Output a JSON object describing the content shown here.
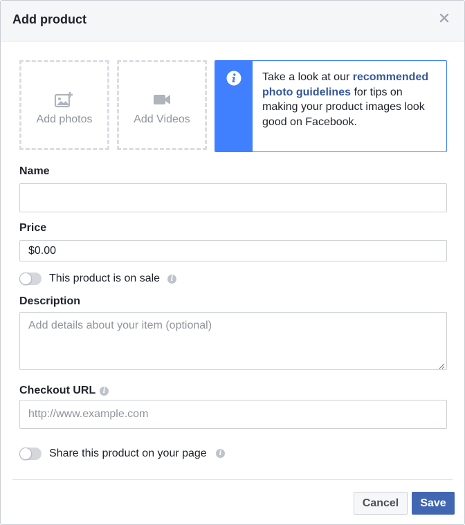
{
  "dialog": {
    "title": "Add product"
  },
  "media": {
    "add_photos_label": "Add photos",
    "add_videos_label": "Add Videos"
  },
  "info": {
    "text_before": "Take a look at our ",
    "link_text": "recommended photo guidelines",
    "text_after": " for tips on making your product images look good on Facebook."
  },
  "form": {
    "name_label": "Name",
    "name_value": "",
    "price_label": "Price",
    "price_value": "$0.00",
    "sale_toggle_label": "This product is on sale",
    "description_label": "Description",
    "description_placeholder": "Add details about your item (optional)",
    "checkout_label": "Checkout URL",
    "checkout_placeholder": "http://www.example.com",
    "share_toggle_label": "Share this product on your page"
  },
  "footer": {
    "cancel_label": "Cancel",
    "save_label": "Save"
  },
  "colors": {
    "accent_blue": "#4080ff",
    "link_blue": "#365899",
    "save_button": "#4267b2"
  }
}
